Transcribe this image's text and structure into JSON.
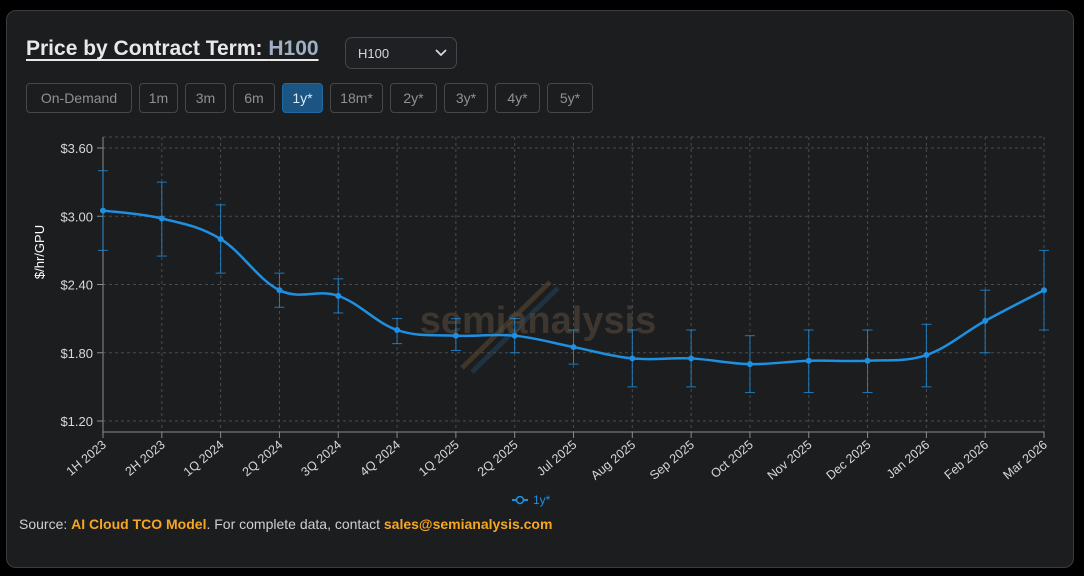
{
  "header": {
    "title_prefix": "Price by Contract Term: ",
    "title_gpu": "H100",
    "gpu_select_value": "H100"
  },
  "tabs": [
    {
      "label": "On-Demand",
      "active": false
    },
    {
      "label": "1m",
      "active": false
    },
    {
      "label": "3m",
      "active": false
    },
    {
      "label": "6m",
      "active": false
    },
    {
      "label": "1y*",
      "active": true
    },
    {
      "label": "18m*",
      "active": false
    },
    {
      "label": "2y*",
      "active": false
    },
    {
      "label": "3y*",
      "active": false
    },
    {
      "label": "4y*",
      "active": false
    },
    {
      "label": "5y*",
      "active": false
    }
  ],
  "watermark": "semianalysis",
  "colors": {
    "series": "#1f8fe0",
    "grid": "#4a4b4e",
    "accent_orange": "#f5a623",
    "active_tab": "#1a5584"
  },
  "chart_data": {
    "type": "line",
    "title": "",
    "xlabel": "",
    "ylabel": "$/hr/GPU",
    "ylim": [
      1.2,
      3.6
    ],
    "yticks": [
      1.2,
      1.8,
      2.4,
      3.0,
      3.6
    ],
    "ytick_labels": [
      "$1.20",
      "$1.80",
      "$2.40",
      "$3.00",
      "$3.60"
    ],
    "categories": [
      "1H 2023",
      "2H 2023",
      "1Q 2024",
      "2Q 2024",
      "3Q 2024",
      "4Q 2024",
      "1Q 2025",
      "2Q 2025",
      "Jul 2025",
      "Aug 2025",
      "Sep 2025",
      "Oct 2025",
      "Nov 2025",
      "Dec 2025",
      "Jan 2026",
      "Feb 2026",
      "Mar 2026"
    ],
    "grid": true,
    "legend": "bottom-center",
    "series": [
      {
        "name": "1y*",
        "values": [
          3.05,
          2.98,
          2.8,
          2.35,
          2.3,
          2.0,
          1.95,
          1.95,
          1.85,
          1.75,
          1.75,
          1.7,
          1.73,
          1.73,
          1.78,
          2.08,
          2.35
        ],
        "error_low": [
          2.7,
          2.65,
          2.5,
          2.2,
          2.15,
          1.88,
          1.82,
          1.8,
          1.7,
          1.5,
          1.5,
          1.45,
          1.45,
          1.45,
          1.5,
          1.8,
          2.0
        ],
        "error_high": [
          3.4,
          3.3,
          3.1,
          2.5,
          2.45,
          2.1,
          2.1,
          2.1,
          2.0,
          2.0,
          2.0,
          1.95,
          2.0,
          2.0,
          2.05,
          2.35,
          2.7
        ]
      }
    ]
  },
  "footer": {
    "source_prefix": "Source: ",
    "source_link": "AI Cloud TCO Model",
    "source_mid": ". For complete data, contact ",
    "email": "sales@semianalysis.com"
  }
}
